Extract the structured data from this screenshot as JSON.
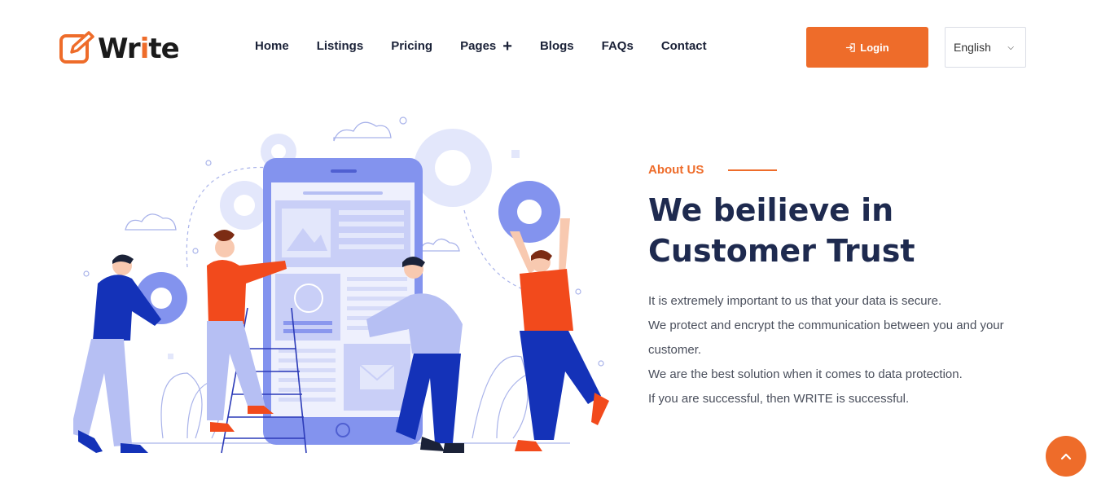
{
  "brand": {
    "logo_text_a": "Wr",
    "logo_text_b": "i",
    "logo_text_c": "te",
    "accent_color": "#ee6c2a",
    "dark_color": "#1e2a4f"
  },
  "nav": {
    "items": [
      {
        "label": "Home"
      },
      {
        "label": "Listings"
      },
      {
        "label": "Pricing"
      },
      {
        "label": "Pages",
        "has_submenu": true
      },
      {
        "label": "Blogs"
      },
      {
        "label": "FAQs"
      },
      {
        "label": "Contact"
      }
    ]
  },
  "header": {
    "login_label": "Login",
    "login_icon": "login-icon",
    "language_value": "English"
  },
  "about": {
    "tag": "About US",
    "title_line1": "We beilieve in",
    "title_line2": "Customer Trust",
    "paragraphs": [
      "It is extremely important to us that your data is secure.",
      "We protect and encrypt the communication between you and your customer.",
      "We are the best solution when it comes to data protection.",
      "If you are successful, then WRITE is successful."
    ]
  },
  "scroll_top": {
    "icon": "chevron-up-icon"
  }
}
